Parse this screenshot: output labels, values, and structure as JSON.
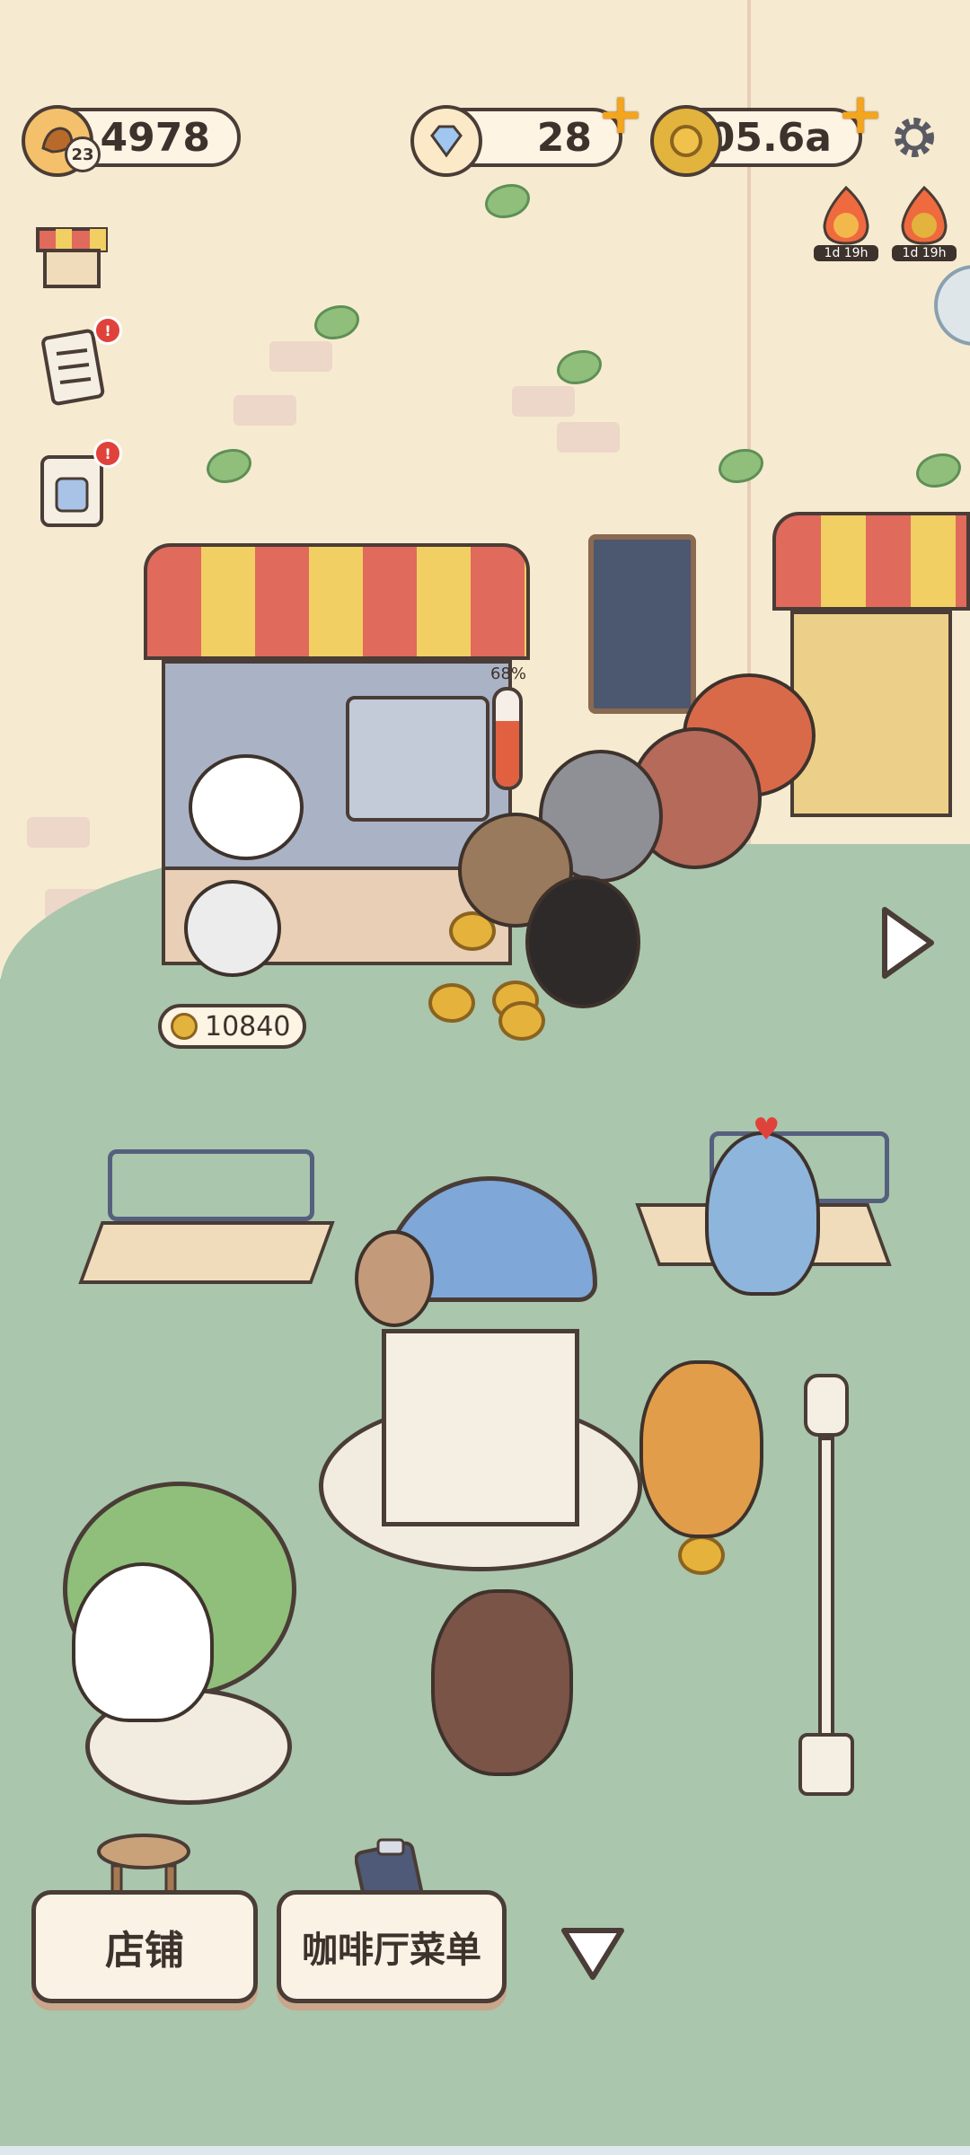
{
  "hud": {
    "bakery_value": "4978",
    "level": "23",
    "diamonds": "28",
    "coins": "105.6a"
  },
  "events": [
    {
      "timer": "1d 19h"
    },
    {
      "timer": "1d 19h"
    }
  ],
  "side_menu": {
    "notification_mark": "!"
  },
  "stall": {
    "fill_percent": "68%",
    "collected_coins": "10840"
  },
  "bottom_bar": {
    "shop_label": "店铺",
    "menu_label": "咖啡厅菜单"
  },
  "colors": {
    "wall": "#f6ebd0",
    "lawn": "#aac6ac",
    "outline": "#4a3c36",
    "accent_gold": "#f3a51e",
    "alert_red": "#e0423b"
  },
  "icons": [
    "bakery-icon",
    "diamond-icon",
    "coin-icon",
    "plus-icon",
    "gear-icon",
    "shop-icon",
    "checklist-icon",
    "calendar-icon",
    "play-arrow-icon",
    "chevron-down-icon",
    "fire-event-icon"
  ]
}
